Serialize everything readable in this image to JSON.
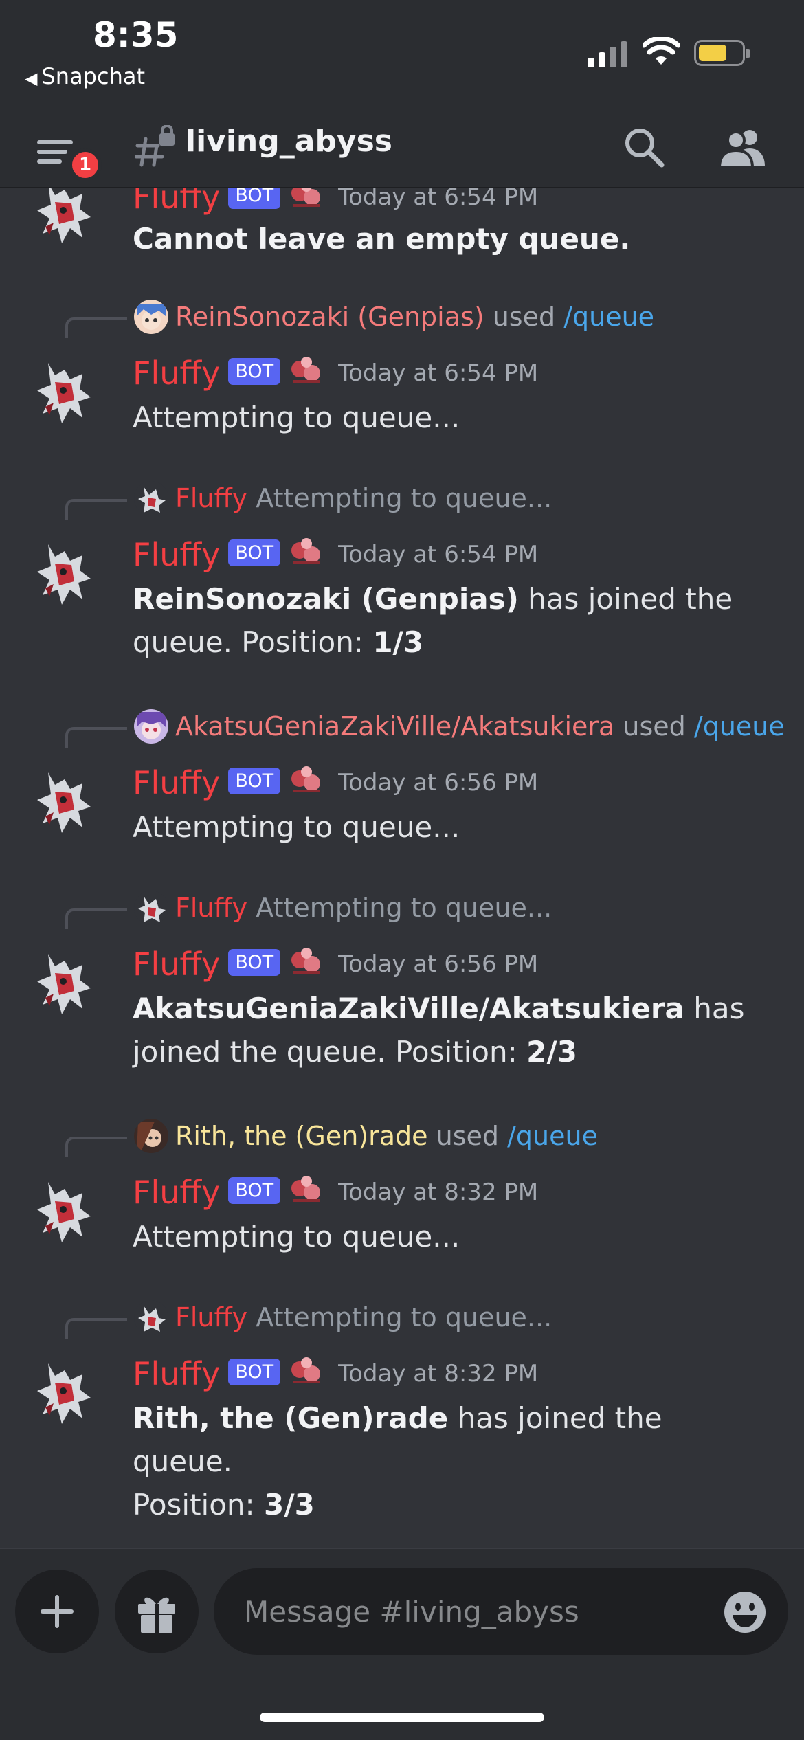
{
  "status_bar": {
    "time": "8:35",
    "back_app": "Snapchat"
  },
  "header": {
    "channel_name": "living_abyss",
    "unread_badge": "1"
  },
  "top_partial": {
    "author": "Fluffy",
    "bot_tag": "BOT",
    "timestamp": "Today at 6:54 PM",
    "text": "Cannot leave an empty queue."
  },
  "messages": [
    {
      "reply": {
        "user": "ReinSonozaki (Genpias)",
        "used": "used",
        "command": "/queue"
      },
      "author": "Fluffy",
      "bot_tag": "BOT",
      "timestamp": "Today at 6:54 PM",
      "text": "Attempting to queue..."
    },
    {
      "reply": {
        "user": "Fluffy",
        "preview": "Attempting to queue..."
      },
      "author": "Fluffy",
      "bot_tag": "BOT",
      "timestamp": "Today at 6:54 PM",
      "bold_name": "ReinSonozaki (Genpias)",
      "text_a": "has joined the",
      "text_b": "queue. Position:",
      "position": "1/3"
    },
    {
      "reply": {
        "user": "AkatsuGeniaZakiVille/Akatsukiera",
        "used": "used",
        "command": "/queue"
      },
      "author": "Fluffy",
      "bot_tag": "BOT",
      "timestamp": "Today at 6:56 PM",
      "text": "Attempting to queue..."
    },
    {
      "reply": {
        "user": "Fluffy",
        "preview": "Attempting to queue..."
      },
      "author": "Fluffy",
      "bot_tag": "BOT",
      "timestamp": "Today at 6:56 PM",
      "bold_name": "AkatsuGeniaZakiVille/Akatsukiera",
      "text_a": "has",
      "text_b": "joined the queue. Position:",
      "position": "2/3"
    },
    {
      "reply": {
        "user": "Rith, the (Gen)rade",
        "used": "used",
        "command": "/queue"
      },
      "author": "Fluffy",
      "bot_tag": "BOT",
      "timestamp": "Today at 8:32 PM",
      "text": "Attempting to queue..."
    },
    {
      "reply": {
        "user": "Fluffy",
        "preview": "Attempting to queue..."
      },
      "author": "Fluffy",
      "bot_tag": "BOT",
      "timestamp": "Today at 8:32 PM",
      "bold_name": "Rith, the (Gen)rade",
      "text_a": "has joined the queue.",
      "text_b": "Position:",
      "position": "3/3"
    }
  ],
  "composer": {
    "placeholder": "Message #living_abyss"
  },
  "colors": {
    "background": "#313338",
    "header": "#2b2d31",
    "bot_tag": "#5865f2",
    "author": "#f23f43",
    "command": "#4aa6ea",
    "badge": "#f23f43"
  },
  "icons": [
    "back-triangle-icon",
    "signal-icon",
    "wifi-icon",
    "battery-icon",
    "menu-icon",
    "channel-hash-lock-icon",
    "search-icon",
    "members-icon",
    "plus-icon",
    "gift-icon",
    "emoji-icon"
  ]
}
